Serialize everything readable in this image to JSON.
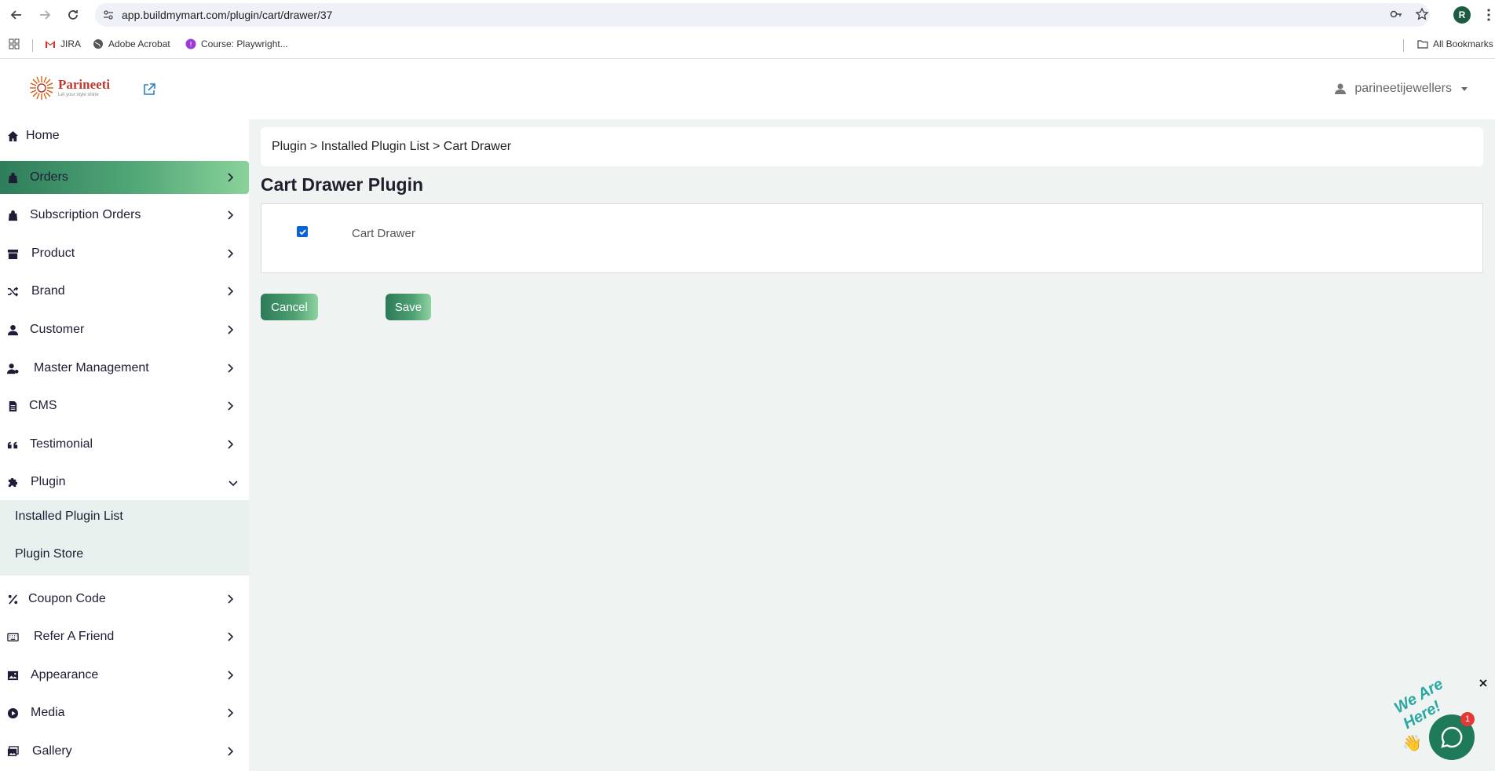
{
  "browser": {
    "url": "app.buildmymart.com/plugin/cart/drawer/37",
    "profile_initial": "R",
    "bookmarks": [
      {
        "label": "JIRA",
        "icon": "gmail-icon"
      },
      {
        "label": "Adobe Acrobat",
        "icon": "globe-icon"
      },
      {
        "label": "Course: Playwright...",
        "icon": "course-icon"
      }
    ],
    "all_bookmarks": "All Bookmarks"
  },
  "header": {
    "logo_name": "Parineeti",
    "logo_tagline": "Let your style shine",
    "username": "parineetijewellers"
  },
  "sidebar": {
    "items": [
      {
        "label": "Home",
        "icon": "home-icon"
      },
      {
        "label": "Orders",
        "icon": "bag-icon"
      },
      {
        "label": "Subscription Orders",
        "icon": "bag-icon"
      },
      {
        "label": "Product",
        "icon": "archive-icon"
      },
      {
        "label": "Brand",
        "icon": "shuffle-icon"
      },
      {
        "label": "Customer",
        "icon": "user-icon"
      },
      {
        "label": "Master Management",
        "icon": "user-gear-icon"
      },
      {
        "label": "CMS",
        "icon": "file-icon"
      },
      {
        "label": "Testimonial",
        "icon": "quote-icon"
      },
      {
        "label": "Plugin",
        "icon": "puzzle-icon"
      },
      {
        "label": "Coupon Code",
        "icon": "percent-icon"
      },
      {
        "label": "Refer A Friend",
        "icon": "keyboard-icon"
      },
      {
        "label": "Appearance",
        "icon": "image-icon"
      },
      {
        "label": "Media",
        "icon": "play-circle-icon"
      },
      {
        "label": "Gallery",
        "icon": "images-icon"
      }
    ],
    "plugin_submenu": [
      {
        "label": "Installed Plugin List"
      },
      {
        "label": "Plugin Store"
      }
    ]
  },
  "main": {
    "breadcrumb": "Plugin > Installed Plugin List > Cart Drawer",
    "title": "Cart Drawer Plugin",
    "checkbox_label": "Cart Drawer",
    "checkbox_checked": true,
    "cancel_label": "Cancel",
    "save_label": "Save"
  },
  "chat": {
    "banner": "We Are Here!",
    "count": "1"
  },
  "colors": {
    "accent_start": "#2c7a58",
    "accent_end": "#8fd3a1",
    "main_bg": "#eff4f3",
    "checkbox": "#0b63d3"
  }
}
